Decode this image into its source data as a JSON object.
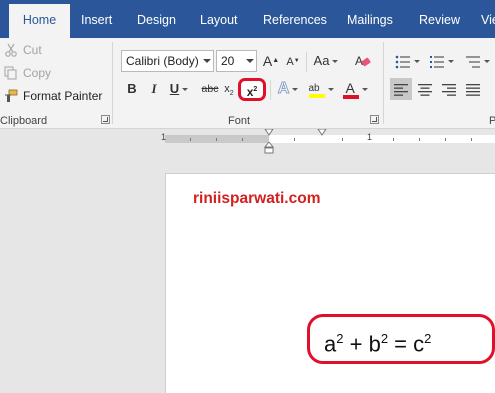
{
  "tabs": [
    {
      "label": "Home",
      "active": true
    },
    {
      "label": "Insert",
      "active": false
    },
    {
      "label": "Design",
      "active": false
    },
    {
      "label": "Layout",
      "active": false
    },
    {
      "label": "References",
      "active": false
    },
    {
      "label": "Mailings",
      "active": false
    },
    {
      "label": "Review",
      "active": false
    },
    {
      "label": "Vie",
      "active": false
    }
  ],
  "clipboard": {
    "cut_label": "Cut",
    "copy_label": "Copy",
    "format_painter_label": "Format Painter",
    "group_label": "Clipboard"
  },
  "font": {
    "font_name": "Calibri (Body)",
    "font_size": "20",
    "grow_label": "A",
    "shrink_label": "A",
    "case_label": "Aa",
    "bold_label": "B",
    "italic_label": "I",
    "underline_label": "U",
    "strike_label": "abc",
    "subscript_label": "x",
    "subscript_sub": "2",
    "superscript_label": "x",
    "superscript_sup": "2",
    "effects_label": "A",
    "highlight_label": "ab",
    "font_color_label": "A",
    "group_label": "Font"
  },
  "paragraph_group_label_partial": "P",
  "ruler": {
    "numbers": [
      "1",
      "1"
    ]
  },
  "document": {
    "watermark": "riniisparwati.com",
    "equation": {
      "a": "a",
      "a_exp": "2",
      "plus": " + ",
      "b": "b",
      "b_exp": "2",
      "eq": " = ",
      "c": "c",
      "c_exp": "2"
    }
  },
  "colors": {
    "accent": "#2b579a",
    "highlight_red": "#e0102a",
    "watermark_red": "#d42020",
    "highlight_yellow": "#ffff00"
  }
}
